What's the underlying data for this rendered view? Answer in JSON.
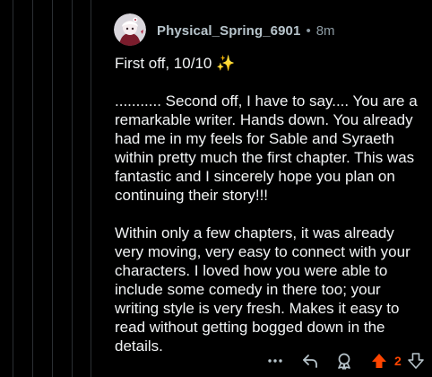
{
  "comment": {
    "username": "Physical_Spring_6901",
    "separator": "•",
    "time": "8m",
    "paragraphs": [
      "First off, 10/10 ✨",
      "........... Second off, I have to say.... You are a remarkable writer. Hands down. You already had me in my feels for Sable and Syraeth within pretty much the first chapter. This was fantastic and I sincerely hope you plan on continuing their story!!!",
      "Within only a few chapters, it was already very moving, very easy to connect with your characters. I loved how you were able to include some comedy in there too; your writing style is very fresh. Makes it easy to read without getting bogged down in the details."
    ]
  },
  "actions": {
    "more_icon": "more-horizontal-icon",
    "reply_icon": "reply-arrow-icon",
    "award_icon": "award-icon",
    "upvote_icon": "upvote-arrow-icon",
    "downvote_icon": "downvote-arrow-icon",
    "score": "2"
  },
  "colors": {
    "background": "#000000",
    "text": "#f2f4f5",
    "meta": "#8c9aa2",
    "username": "#b8c5cc",
    "upvoted": "#ff4500",
    "icon": "#b8c5cc"
  }
}
